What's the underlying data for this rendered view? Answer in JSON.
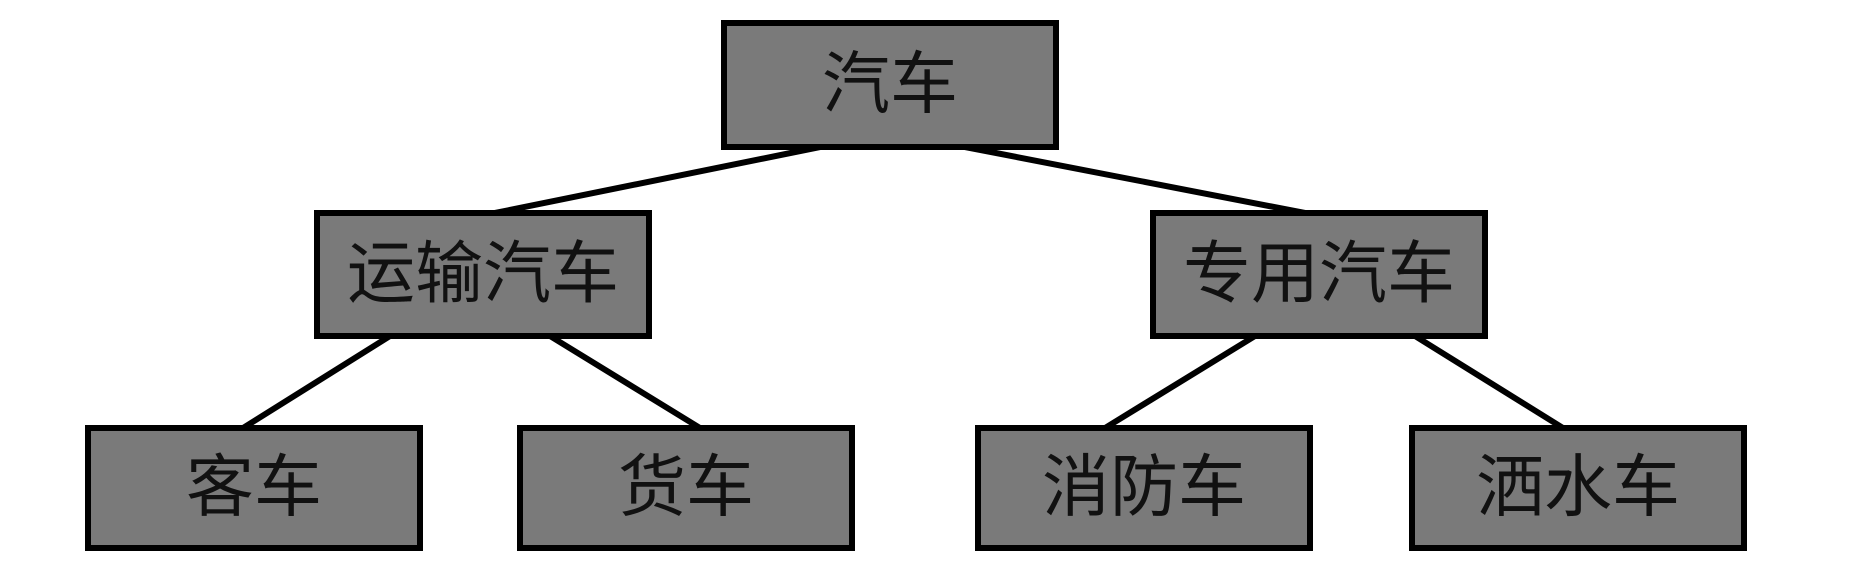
{
  "diagram": {
    "type": "tree",
    "colors": {
      "node_fill": "#7a7a7a",
      "border": "#000000",
      "text": "#111111",
      "background": "#ffffff"
    },
    "root": {
      "label": "汽车"
    },
    "branches": [
      {
        "label": "运输汽车",
        "children": [
          {
            "label": "客车"
          },
          {
            "label": "货车"
          }
        ]
      },
      {
        "label": "专用汽车",
        "children": [
          {
            "label": "消防车"
          },
          {
            "label": "洒水车"
          }
        ]
      }
    ]
  }
}
